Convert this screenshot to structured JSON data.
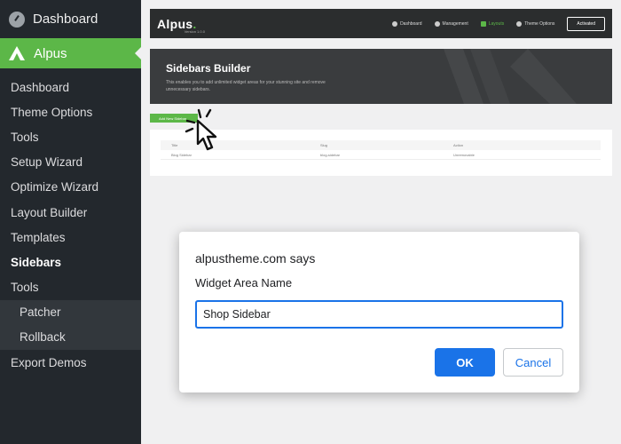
{
  "sidebar": {
    "dashboard": "Dashboard",
    "active_plugin": "Alpus",
    "items": [
      {
        "label": "Dashboard"
      },
      {
        "label": "Theme Options"
      },
      {
        "label": "Tools"
      },
      {
        "label": "Setup Wizard"
      },
      {
        "label": "Optimize Wizard"
      },
      {
        "label": "Layout Builder"
      },
      {
        "label": "Templates"
      },
      {
        "label": "Sidebars"
      },
      {
        "label": "Tools"
      }
    ],
    "subitems": [
      {
        "label": "Patcher"
      },
      {
        "label": "Rollback"
      }
    ],
    "export": "Export Demos"
  },
  "topbar": {
    "brand": "Alpus",
    "version": "Version 1.0.0",
    "nav": [
      {
        "label": "Dashboard"
      },
      {
        "label": "Management"
      },
      {
        "label": "Layouts"
      },
      {
        "label": "Theme Options"
      }
    ],
    "activated": "Activated"
  },
  "banner": {
    "title": "Sidebars Builder",
    "description": "This enables you to add unlimited widget areas for your stunning site and remove unnecessary sidebars."
  },
  "add_button": "Add New Sidebar",
  "table": {
    "headers": [
      "Title",
      "Slug",
      "Action"
    ],
    "rows": [
      [
        "Blog Sidebar",
        "blog-sidebar",
        "Unremovable"
      ]
    ]
  },
  "dialog": {
    "title": "alpustheme.com says",
    "label": "Widget Area Name",
    "value": "Shop Sidebar",
    "ok": "OK",
    "cancel": "Cancel"
  },
  "colors": {
    "accent": "#5cb748",
    "dialog_primary": "#1a73e8",
    "sidebar_bg": "#23282d"
  }
}
